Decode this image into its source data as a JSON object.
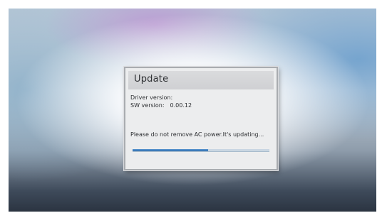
{
  "dialog": {
    "title": "Update",
    "driver_version_label": "Driver version:",
    "driver_version_value": "",
    "sw_version_label": "SW version:",
    "sw_version_value": "0.00.12",
    "message": "Please do not remove AC power.It's updating...",
    "progress_fraction": 0.55
  }
}
